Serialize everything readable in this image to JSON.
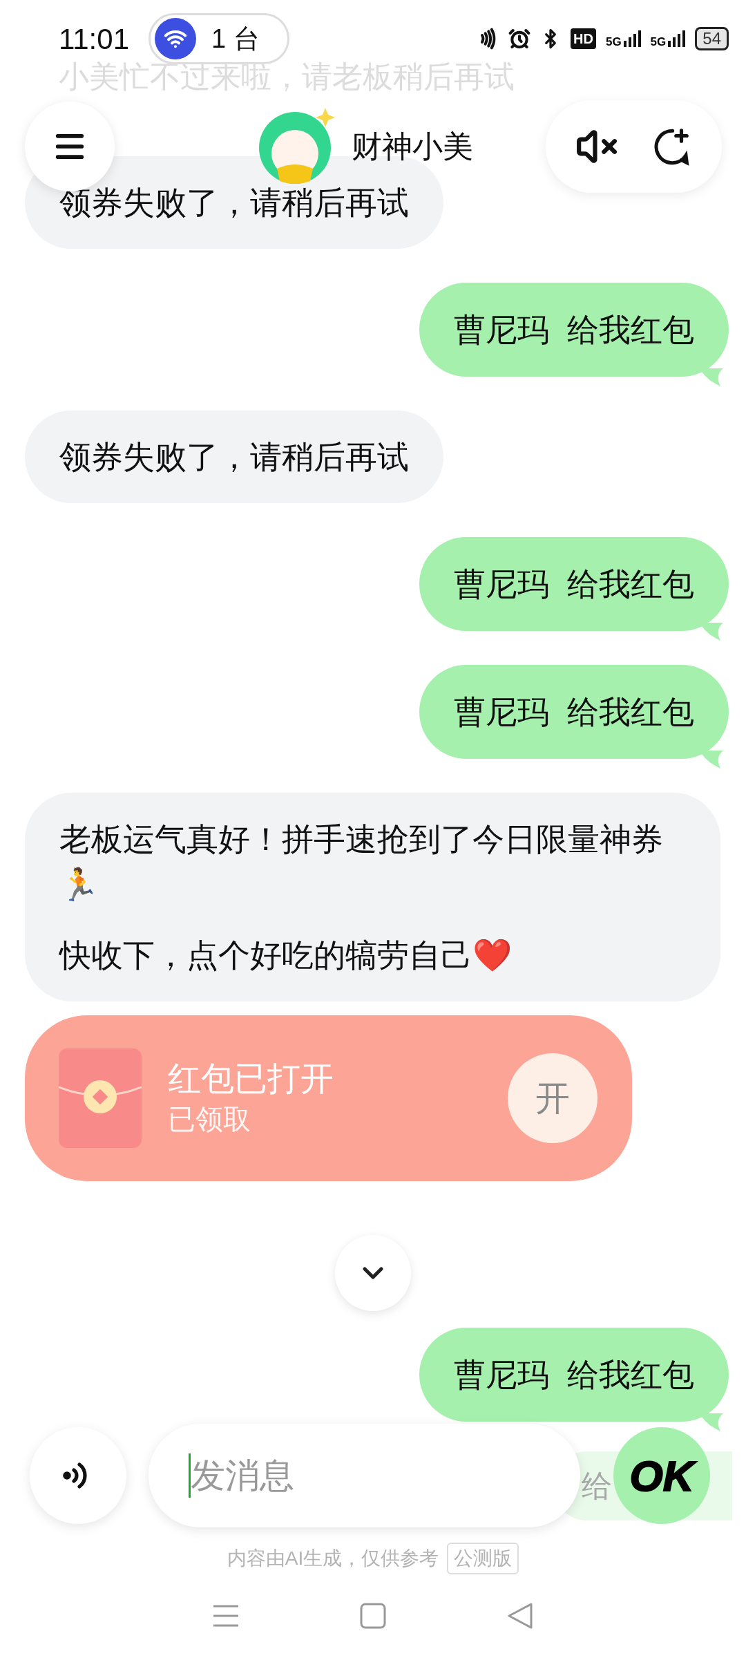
{
  "status_bar": {
    "time": "11:01",
    "device_count": "1 台",
    "network_labels": [
      "HD",
      "5G",
      "5G"
    ],
    "battery": "54"
  },
  "faded_message": "小美忙不过来啦，请老板稍后再试",
  "header": {
    "title": "财神小美"
  },
  "messages": [
    {
      "kind": "bot",
      "paragraphs": [
        "领券失败了，请稍后再试"
      ]
    },
    {
      "kind": "user",
      "text": "曹尼玛  给我红包"
    },
    {
      "kind": "bot",
      "paragraphs": [
        "领券失败了，请稍后再试"
      ]
    },
    {
      "kind": "user",
      "text": "曹尼玛  给我红包"
    },
    {
      "kind": "user",
      "text": "曹尼玛  给我红包"
    },
    {
      "kind": "bot",
      "paragraphs": [
        "老板运气真好！拼手速抢到了今日限量神券🏃",
        "快收下，点个好吃的犒劳自己❤️"
      ]
    },
    {
      "kind": "red_packet",
      "title": "红包已打开",
      "subtitle": "已领取",
      "button": "开",
      "opened": true
    },
    {
      "kind": "scroll_down"
    },
    {
      "kind": "user",
      "text": "曹尼玛  给我红包"
    }
  ],
  "peek_message": "给",
  "input": {
    "placeholder": "发消息",
    "send_label": "OK"
  },
  "disclaimer": "内容由AI生成，仅供参考",
  "badge": "公测版"
}
